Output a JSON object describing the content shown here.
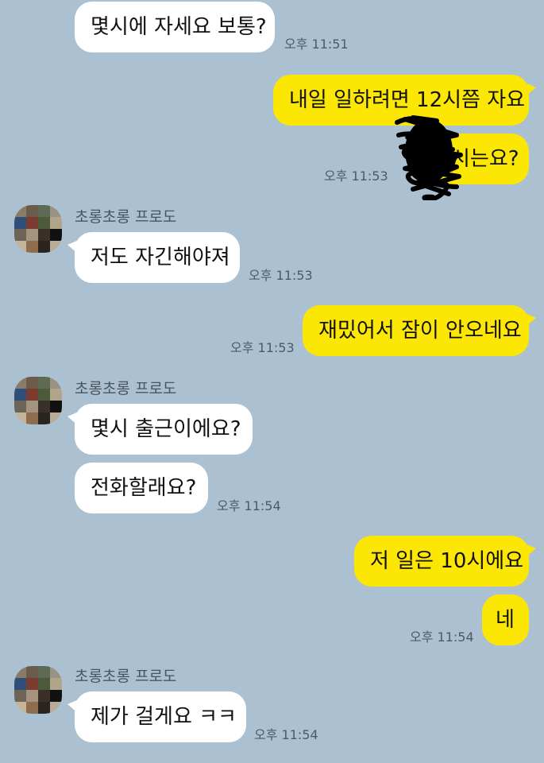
{
  "chat": {
    "messages": [
      {
        "id": "m1",
        "dir": "in",
        "text": "몇시에 자세요 보통?",
        "time": "오후 11:51"
      },
      {
        "id": "m2",
        "dir": "out",
        "text": "내일 일하려면 12시쯤 자요",
        "time": ""
      },
      {
        "id": "m3",
        "dir": "out",
        "text": "시는요?",
        "time": "오후 11:53",
        "redacted": true
      },
      {
        "id": "m4",
        "dir": "in",
        "sender": "초롱초롱 프로도",
        "text": "저도 자긴해야져",
        "time": "오후 11:53"
      },
      {
        "id": "m5",
        "dir": "out",
        "text": "재밌어서 잠이 안오네요",
        "time": "오후 11:53"
      },
      {
        "id": "m6",
        "dir": "in",
        "sender": "초롱초롱 프로도",
        "text": "몇시 출근이에요?",
        "time": ""
      },
      {
        "id": "m7",
        "dir": "in",
        "text": "전화할래요?",
        "time": "오후 11:54"
      },
      {
        "id": "m8",
        "dir": "out",
        "text": "저 일은 10시에요",
        "time": ""
      },
      {
        "id": "m9",
        "dir": "out",
        "text": "네",
        "time": "오후 11:54"
      },
      {
        "id": "m10",
        "dir": "in",
        "sender": "초롱초롱 프로도",
        "text": "제가 걸게요 ㅋㅋ",
        "time": "오후 11:54"
      }
    ]
  },
  "colors": {
    "background": "#abc1d1",
    "outgoing_bubble": "#fce603",
    "incoming_bubble": "#ffffff",
    "timestamp": "#4e5a63"
  },
  "icons": {
    "avatar": "pixelated-profile-photo",
    "redaction": "black-marker-scribble"
  }
}
